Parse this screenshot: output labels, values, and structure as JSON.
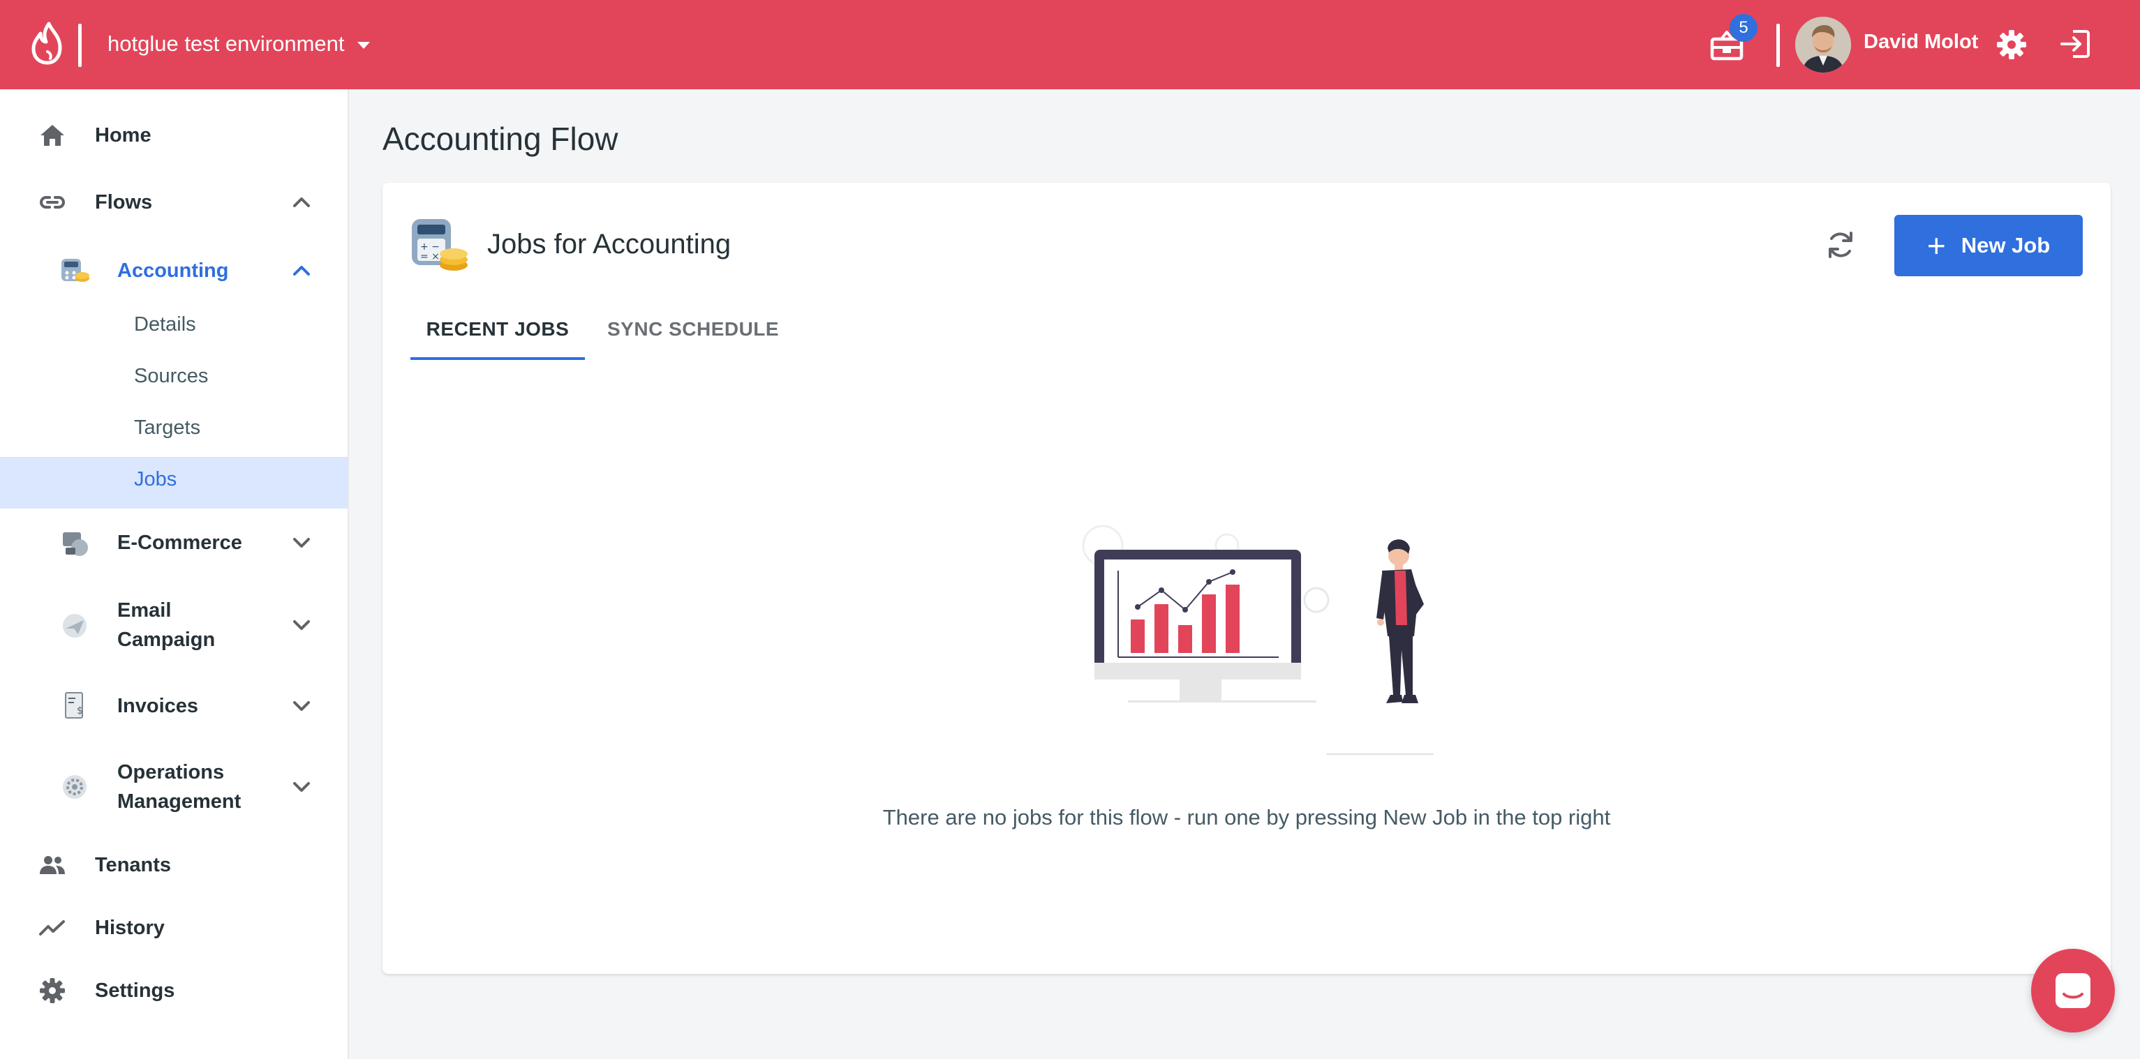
{
  "topbar": {
    "environment": "hotglue test environment",
    "notifications_count": "5",
    "user_name": "David Molot",
    "brand_color": "#e2455a"
  },
  "sidebar": {
    "home": "Home",
    "flows": "Flows",
    "accounting": "Accounting",
    "accounting_children": [
      "Details",
      "Sources",
      "Targets",
      "Jobs"
    ],
    "ecommerce": "E-Commerce",
    "email_campaign": [
      "Email",
      "Campaign"
    ],
    "invoices": "Invoices",
    "operations": [
      "Operations",
      "Management"
    ],
    "tenants": "Tenants",
    "history": "History",
    "settings": "Settings",
    "active_item": "Jobs"
  },
  "main": {
    "page_title": "Accounting Flow",
    "card_title": "Jobs for Accounting",
    "new_job_label": "New Job",
    "tabs": [
      "RECENT JOBS",
      "SYNC SCHEDULE"
    ],
    "active_tab": "RECENT JOBS",
    "empty_message": "There are no jobs for this flow - run one by pressing New Job in the top right"
  },
  "colors": {
    "accent": "#2f6fde",
    "active_bg": "#dbe6ff",
    "illustration_red": "#e2455a"
  }
}
